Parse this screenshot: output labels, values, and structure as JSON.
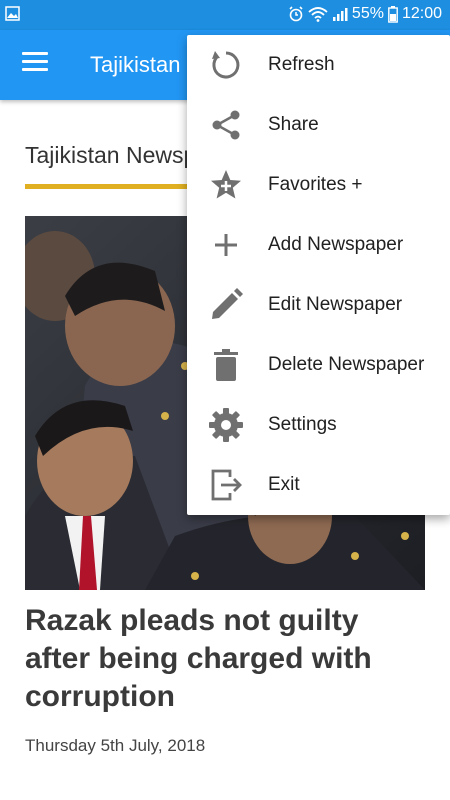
{
  "status_bar": {
    "battery": "55%",
    "time": "12:00"
  },
  "app_bar": {
    "title": "Tajikistan Newspapers"
  },
  "section": {
    "title": "Tajikistan Newspapers"
  },
  "article": {
    "headline": "Razak pleads not guilty after being charged with corruption",
    "date": "Thursday 5th July, 2018"
  },
  "menu": {
    "items": [
      {
        "label": "Refresh",
        "icon": "refresh-icon"
      },
      {
        "label": "Share",
        "icon": "share-icon"
      },
      {
        "label": "Favorites +",
        "icon": "star-plus-icon"
      },
      {
        "label": "Add Newspaper",
        "icon": "plus-icon"
      },
      {
        "label": "Edit Newspaper",
        "icon": "pencil-icon"
      },
      {
        "label": "Delete Newspaper",
        "icon": "trash-icon"
      },
      {
        "label": "Settings",
        "icon": "gear-icon"
      },
      {
        "label": "Exit",
        "icon": "exit-icon"
      }
    ]
  },
  "colors": {
    "status_bar": "#1e8fe0",
    "app_bar": "#2196f3",
    "underline": "#e0b022",
    "menu_icon": "#707070"
  }
}
